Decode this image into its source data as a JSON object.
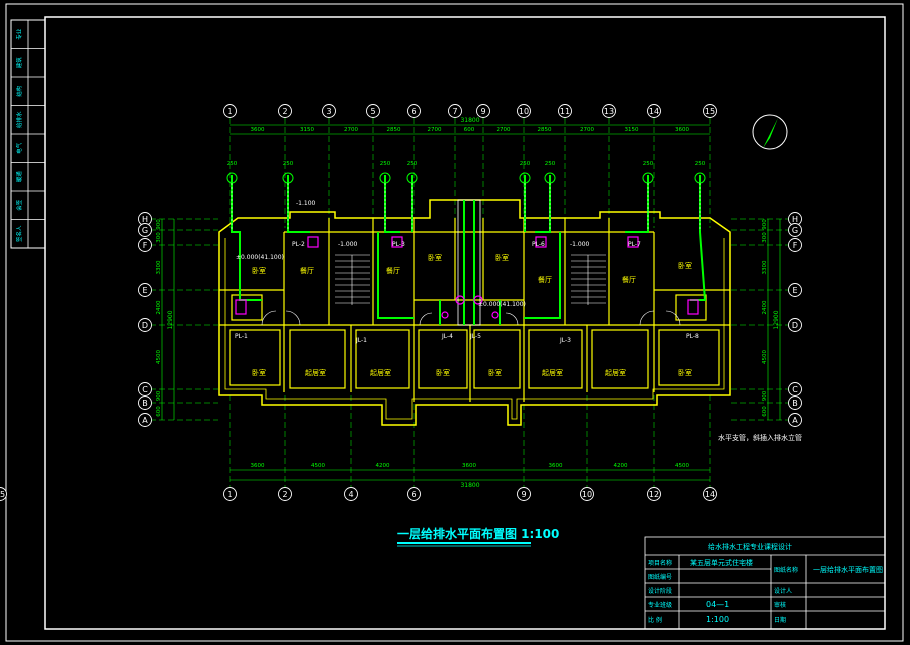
{
  "colors": {
    "background": "#000000",
    "frame": "#ffffff",
    "wall": "#ffff00",
    "dim": "#00ff00",
    "axis": "#ffffff",
    "pipe_cold": "#00ff00",
    "pipe_fixture": "#ff00ff",
    "room_text": "#ffff00",
    "title_text": "#00ffff",
    "table_text": "#00ffff",
    "table_line": "#ffffff"
  },
  "side_strip": {
    "cells": [
      "专业",
      "建筑",
      "结构",
      "给排水",
      "电气",
      "暖通",
      "会签",
      "签名人"
    ]
  },
  "axes": {
    "top_labels": [
      "1",
      "2",
      "3",
      "5",
      "6",
      "7",
      "9",
      "10",
      "11",
      "13",
      "14",
      "15"
    ],
    "bottom_labels": [
      "1",
      "2",
      "4",
      "6",
      "9",
      "10",
      "12",
      "14",
      "15"
    ],
    "left_labels": [
      "H",
      "G",
      "F",
      "E",
      "D",
      "C",
      "B",
      "A"
    ],
    "right_labels": [
      "H",
      "G",
      "F",
      "E",
      "D",
      "C",
      "B",
      "A"
    ]
  },
  "dimensions": {
    "top_segments": [
      "3600",
      "3150",
      "2700",
      "2850",
      "2700",
      "600",
      "2700",
      "2850",
      "2700",
      "3150",
      "3600"
    ],
    "top_total": "31800",
    "bottom_segments": [
      "3600",
      "4500",
      "4200",
      "3600",
      "3600",
      "4200",
      "4500",
      "3600"
    ],
    "bottom_total": "31800",
    "left_segments": [
      "900",
      "300",
      "3300",
      "2400",
      "4500",
      "900",
      "600"
    ],
    "left_total": "12900",
    "right_segments": [
      "900",
      "300",
      "3300",
      "2400",
      "4500",
      "900",
      "600"
    ],
    "right_total": "12900",
    "pipe_size": "250"
  },
  "rooms": {
    "bedroom": "卧室",
    "living": "起居室",
    "dining": "餐厅"
  },
  "pipe_labels": {
    "pl1": "PL-1",
    "pl2": "PL-2",
    "pl3": "PL-3",
    "pl4": "PL-4",
    "pl5": "PL-5",
    "pl6": "PL-6",
    "pl7": "PL-7",
    "pl8": "PL-8",
    "jl1": "JL-1",
    "jl2": "JL-2",
    "jl3": "JL-3",
    "jl4": "JL-4",
    "jl5": "JL-5"
  },
  "elevations": {
    "left": "±0.000(41.100)",
    "center": "±0.000(41.100)",
    "stair_left": "-1.000",
    "stair_right": "-1.000",
    "top_left": "-1.100"
  },
  "note": "水平支管，斜插入排水立管",
  "drawing_title": "一层给排水平面布置图 1:100",
  "title_block": {
    "header": "给水排水工程专业课程设计",
    "project_label": "项目名称",
    "project_value": "某五层单元式住宅楼",
    "drawing_label": "图纸名称",
    "drawing_value": "一层给排水平面布置图",
    "row2_label": "图纸编号",
    "row3_label": "设计阶段",
    "designer_label": "设计人",
    "drawing_no": "04—1",
    "professional_label": "专业班级",
    "check_label": "审核",
    "scale_label": "比 例",
    "scale_value": "1:100",
    "date_label": "日期"
  },
  "compass": {
    "label": "N"
  }
}
